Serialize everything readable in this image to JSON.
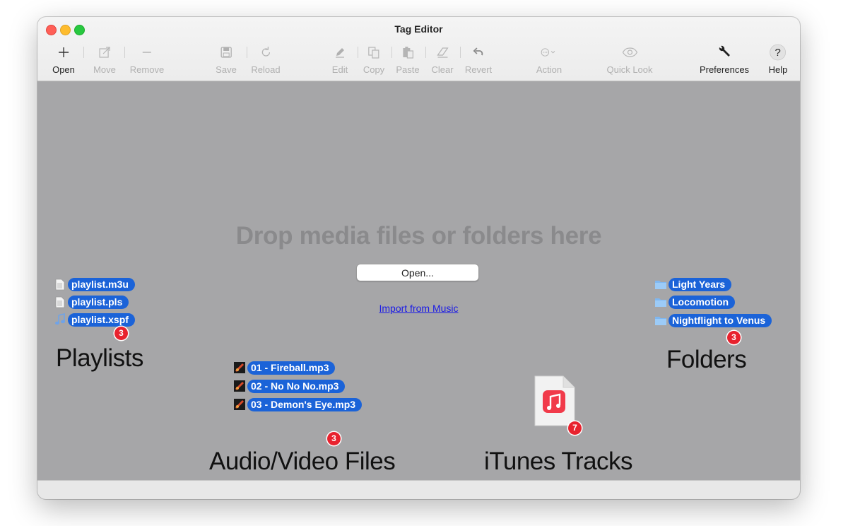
{
  "window": {
    "title": "Tag Editor"
  },
  "toolbar": {
    "open": "Open",
    "move": "Move",
    "remove": "Remove",
    "save": "Save",
    "reload": "Reload",
    "edit": "Edit",
    "copy": "Copy",
    "paste": "Paste",
    "clear": "Clear",
    "revert": "Revert",
    "action": "Action",
    "quick_look": "Quick Look",
    "preferences": "Preferences",
    "help": "Help"
  },
  "main": {
    "drop_text": "Drop media files or folders here",
    "open_button": "Open...",
    "import_link": "Import from Music"
  },
  "playlists": {
    "items": [
      "playlist.m3u",
      "playlist.pls",
      "playlist.xspf"
    ],
    "badge": "3",
    "label": "Playlists"
  },
  "audio": {
    "items": [
      "01 - Fireball.mp3",
      "02 - No No No.mp3",
      "03 - Demon's Eye.mp3"
    ],
    "badge": "3",
    "label": "Audio/Video Files"
  },
  "itunes": {
    "badge": "7",
    "label": "iTunes Tracks"
  },
  "folders": {
    "items": [
      "Light Years",
      "Locomotion",
      "Nightflight to Venus"
    ],
    "badge": "3",
    "label": "Folders"
  },
  "colors": {
    "selection_blue": "#1b63d8",
    "badge_red": "#e8222e",
    "content_gray": "#a6a6a8",
    "link_blue": "#1a1ae6"
  }
}
